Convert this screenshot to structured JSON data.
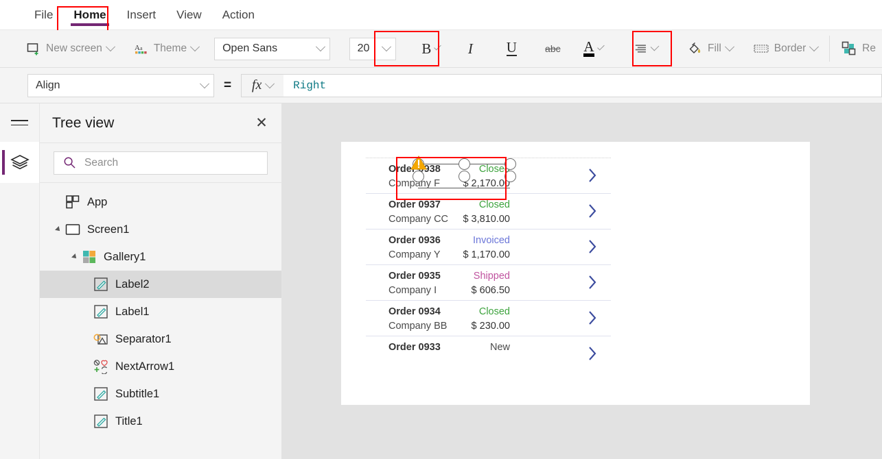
{
  "menubar": {
    "items": [
      {
        "label": "File",
        "active": false
      },
      {
        "label": "Home",
        "active": true
      },
      {
        "label": "Insert",
        "active": false
      },
      {
        "label": "View",
        "active": false
      },
      {
        "label": "Action",
        "active": false
      }
    ],
    "active_tab_accent": "#742774",
    "highlight_color": "#ff0000"
  },
  "ribbon": {
    "new_screen_label": "New screen",
    "theme_label": "Theme",
    "font_family_value": "Open Sans",
    "font_size_value": "20",
    "bold_label": "B",
    "italic_label": "I",
    "underline_label": "U",
    "strikethrough_label": "abc",
    "font_color_label": "A",
    "fill_label": "Fill",
    "border_label": "Border",
    "reorder_label": "Re",
    "font_color_swatch": "#000000"
  },
  "formula_bar": {
    "property_value": "Align",
    "equals": "=",
    "fx_label": "fx",
    "formula_value": "Right",
    "formula_color": "#0f7a85"
  },
  "tree_panel": {
    "title": "Tree view",
    "close_label": "✕",
    "search_placeholder": "Search",
    "items": [
      {
        "label": "App",
        "depth": 0,
        "icon": "app-icon",
        "expander": "none",
        "selected": false
      },
      {
        "label": "Screen1",
        "depth": 0,
        "icon": "screen-icon",
        "expander": "expanded",
        "selected": false
      },
      {
        "label": "Gallery1",
        "depth": 1,
        "icon": "gallery-icon",
        "expander": "expanded",
        "selected": false
      },
      {
        "label": "Label2",
        "depth": 2,
        "icon": "label-icon",
        "expander": "none",
        "selected": true
      },
      {
        "label": "Label1",
        "depth": 2,
        "icon": "label-icon",
        "expander": "none",
        "selected": false
      },
      {
        "label": "Separator1",
        "depth": 2,
        "icon": "separator-icon",
        "expander": "none",
        "selected": false
      },
      {
        "label": "NextArrow1",
        "depth": 2,
        "icon": "nextarrow-icon",
        "expander": "none",
        "selected": false
      },
      {
        "label": "Subtitle1",
        "depth": 2,
        "icon": "label-icon",
        "expander": "none",
        "selected": false
      },
      {
        "label": "Title1",
        "depth": 2,
        "icon": "label-icon",
        "expander": "none",
        "selected": false
      }
    ]
  },
  "canvas": {
    "gallery": {
      "rows": [
        {
          "title": "Order 0938",
          "subtitle": "Company F",
          "status": "Closed",
          "status_color": "#3ea33e",
          "amount": "$ 2,170.00",
          "selected": true
        },
        {
          "title": "Order 0937",
          "subtitle": "Company CC",
          "status": "Closed",
          "status_color": "#3ea33e",
          "amount": "$ 3,810.00",
          "selected": false
        },
        {
          "title": "Order 0936",
          "subtitle": "Company Y",
          "status": "Invoiced",
          "status_color": "#6b76d8",
          "amount": "$ 1,170.00",
          "selected": false
        },
        {
          "title": "Order 0935",
          "subtitle": "Company I",
          "status": "Shipped",
          "status_color": "#c0539f",
          "amount": "$ 606.50",
          "selected": false
        },
        {
          "title": "Order 0934",
          "subtitle": "Company BB",
          "status": "Closed",
          "status_color": "#3ea33e",
          "amount": "$ 230.00",
          "selected": false
        },
        {
          "title": "Order 0933",
          "subtitle": "",
          "status": "New",
          "status_color": "#4a4a4a",
          "amount": "",
          "selected": false
        }
      ],
      "chevron_color": "#3b4b9e"
    },
    "selection": {
      "warning_icon": "warning-triangle-icon",
      "warning_color": "#f5a800"
    }
  }
}
